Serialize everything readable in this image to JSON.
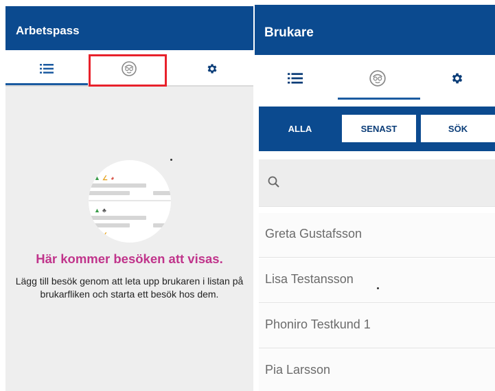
{
  "left": {
    "title": "Arbetspass",
    "tabs": [
      {
        "icon": "list-icon",
        "selected": true
      },
      {
        "icon": "user-face-icon",
        "selected": false,
        "highlighted": true
      },
      {
        "icon": "gear-icon",
        "selected": false
      }
    ],
    "empty_state": {
      "heading": "Här kommer besöken att visas.",
      "body": "Lägg till besök genom att leta upp brukaren i listan på brukarfliken och starta ett besök hos dem."
    }
  },
  "right": {
    "title": "Brukare",
    "tabs": [
      {
        "icon": "list-icon",
        "selected": false
      },
      {
        "icon": "user-face-icon",
        "selected": true
      },
      {
        "icon": "gear-icon",
        "selected": false
      }
    ],
    "filter": {
      "all": "ALLA",
      "recent": "SENAST",
      "search": "SÖK",
      "active": "all"
    },
    "search": {
      "value": "",
      "placeholder": ""
    },
    "clients": [
      "Greta Gustafsson",
      "Lisa Testansson",
      "Phoniro Testkund 1",
      "Pia Larsson"
    ]
  },
  "colors": {
    "appbar": "#0b4a8f",
    "accent_pink": "#c0348b",
    "highlight_red": "#e8212b"
  }
}
